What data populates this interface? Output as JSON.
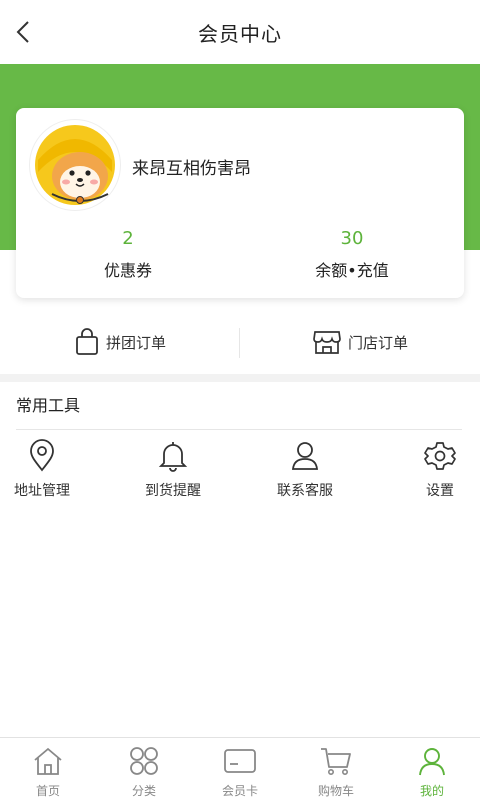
{
  "header": {
    "title": "会员中心"
  },
  "user": {
    "name": "来昂互相伤害昂"
  },
  "stats": [
    {
      "value": "2",
      "label": "优惠券"
    },
    {
      "value": "30",
      "label": "余额•充值"
    }
  ],
  "orders": [
    {
      "label": "拼团订单",
      "icon": "shopping-bag-icon"
    },
    {
      "label": "门店订单",
      "icon": "store-icon"
    }
  ],
  "tools_section": {
    "title": "常用工具",
    "items": [
      {
        "label": "地址管理",
        "icon": "location-pin-icon"
      },
      {
        "label": "到货提醒",
        "icon": "bell-icon"
      },
      {
        "label": "联系客服",
        "icon": "user-icon"
      },
      {
        "label": "设置",
        "icon": "gear-icon"
      }
    ]
  },
  "tabbar": {
    "items": [
      {
        "label": "首页",
        "icon": "home-icon"
      },
      {
        "label": "分类",
        "icon": "category-icon"
      },
      {
        "label": "会员卡",
        "icon": "card-icon"
      },
      {
        "label": "购物车",
        "icon": "cart-icon"
      },
      {
        "label": "我的",
        "icon": "profile-icon",
        "active": true
      }
    ]
  },
  "colors": {
    "accent": "#67b947",
    "accent_text": "#5db33b"
  }
}
